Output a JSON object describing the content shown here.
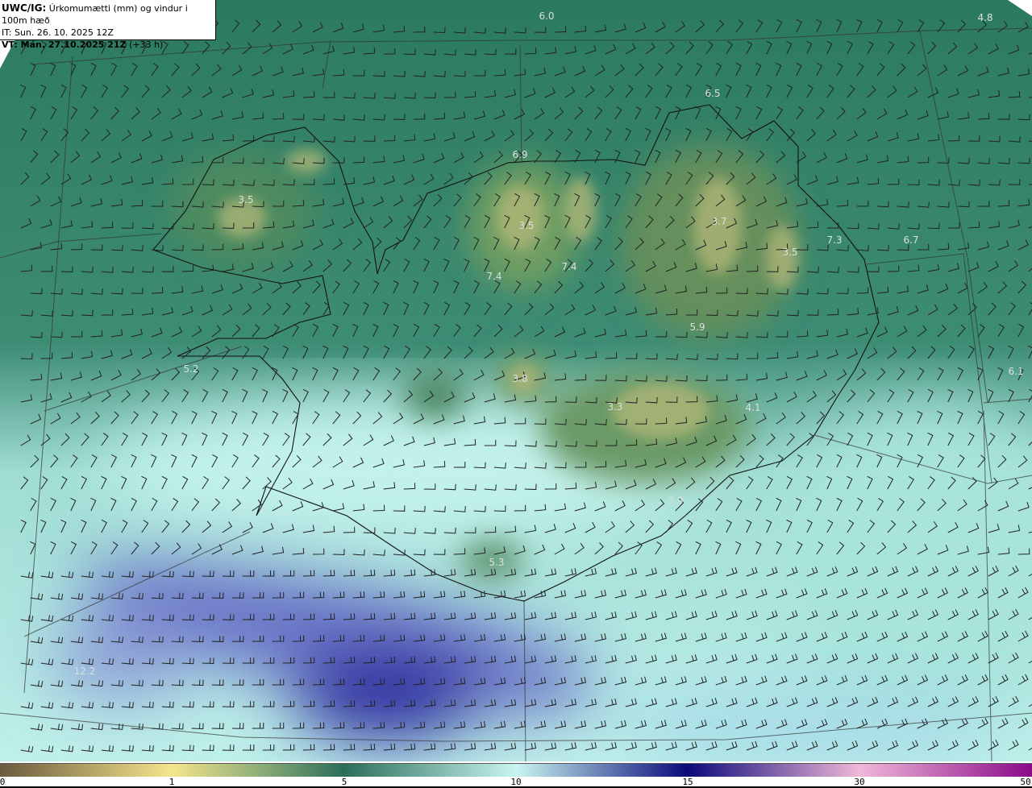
{
  "header": {
    "model_label": "UWC/IG:",
    "title": "Úrkomumætti (mm) og vindur i 100m hæð",
    "initial_time": "IT: Sun. 26. 10. 2025 12Z",
    "valid_label": "VT: Mán. 27.10.2025 21Z",
    "lead_time": "(+33 h)"
  },
  "map_values": [
    {
      "text": "6.0"
    },
    {
      "text": "4.8"
    },
    {
      "text": "6.5"
    },
    {
      "text": "6.9"
    },
    {
      "text": "3.5"
    },
    {
      "text": "3.5"
    },
    {
      "text": "3.7"
    },
    {
      "text": "3.5"
    },
    {
      "text": "7.3"
    },
    {
      "text": "6.7"
    },
    {
      "text": "7.4"
    },
    {
      "text": "7.4"
    },
    {
      "text": "5.9"
    },
    {
      "text": "5.2"
    },
    {
      "text": "3.8"
    },
    {
      "text": "6.1"
    },
    {
      "text": "3.3"
    },
    {
      "text": "4.1"
    },
    {
      "text": "3.9"
    },
    {
      "text": "5.3"
    },
    {
      "text": "12.2"
    }
  ],
  "colorbar": {
    "ticks": [
      "0",
      "1",
      "5",
      "10",
      "15",
      "30",
      "50"
    ],
    "colors": [
      "#6b5a3e",
      "#f5e68c",
      "#8fae78",
      "#2a6e5a",
      "#c8f5f0",
      "#0a0a7a",
      "#f0b8d8",
      "#8a0a8a"
    ]
  },
  "wind_barbs": {
    "prevailing_direction": "southwest",
    "units": "knots"
  }
}
